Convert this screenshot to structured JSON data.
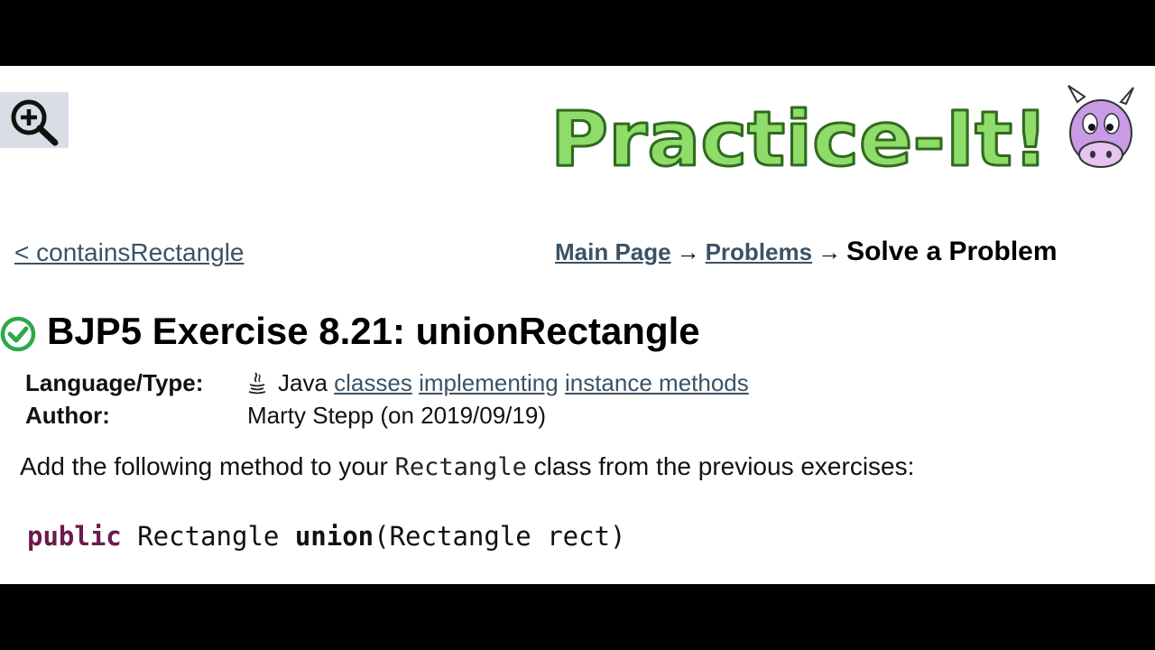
{
  "nav": {
    "back_link": "< containsRectangle",
    "breadcrumb": {
      "main_page": "Main Page",
      "arrow1": "→",
      "problems": "Problems",
      "arrow2": "→",
      "current": "Solve a Problem"
    }
  },
  "logo": {
    "text": "Practice-It!",
    "icon": "cow-mascot-icon"
  },
  "zoom_button": {
    "icon": "zoom-in-icon"
  },
  "problem": {
    "status_icon": "check-circle-icon",
    "title": "BJP5 Exercise 8.21: unionRectangle",
    "language_label": "Language/Type:",
    "language": "Java",
    "tags": [
      "classes",
      "implementing",
      "instance methods"
    ],
    "author_label": "Author:",
    "author": "Marty Stepp (on 2019/09/19)",
    "description_before": "Add the following method to your ",
    "description_code": "Rectangle",
    "description_after": " class from the previous exercises:",
    "code": {
      "keyword": "public",
      "type": " Rectangle ",
      "method": "union",
      "params": "(Rectangle rect)"
    }
  },
  "colors": {
    "link": "#3a5266",
    "logo_green": "#8fdc6a",
    "check_green": "#2ea84a",
    "keyword": "#6b1a4e"
  }
}
